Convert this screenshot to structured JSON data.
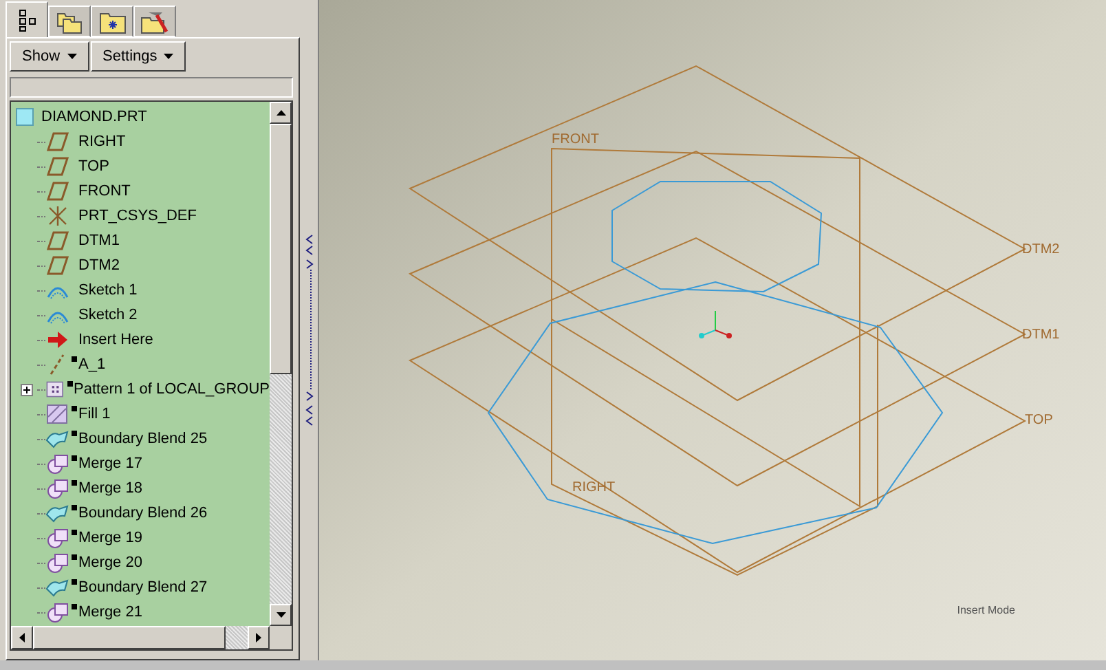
{
  "panel_tabs": [
    {
      "selected": true
    },
    {
      "selected": false
    },
    {
      "selected": false
    },
    {
      "selected": false
    }
  ],
  "toolbar": {
    "buttons": [
      "Show",
      "Settings"
    ]
  },
  "tree": {
    "root": "DIAMOND.PRT",
    "items": [
      {
        "label": "RIGHT",
        "kind": "plane",
        "marked": false
      },
      {
        "label": "TOP",
        "kind": "plane",
        "marked": false
      },
      {
        "label": "FRONT",
        "kind": "plane",
        "marked": false
      },
      {
        "label": "PRT_CSYS_DEF",
        "kind": "csys",
        "marked": false
      },
      {
        "label": "DTM1",
        "kind": "plane",
        "marked": false
      },
      {
        "label": "DTM2",
        "kind": "plane",
        "marked": false
      },
      {
        "label": "Sketch 1",
        "kind": "sketch",
        "marked": false
      },
      {
        "label": "Sketch 2",
        "kind": "sketch",
        "marked": false
      },
      {
        "label": "Insert Here",
        "kind": "insert",
        "marked": false
      },
      {
        "label": "A_1",
        "kind": "axis",
        "marked": true
      },
      {
        "label": "Pattern 1 of LOCAL_GROUP",
        "kind": "pattern",
        "marked": true,
        "expanded": false
      },
      {
        "label": "Fill 1",
        "kind": "fill",
        "marked": true
      },
      {
        "label": "Boundary Blend 25",
        "kind": "blend",
        "marked": true
      },
      {
        "label": "Merge 17",
        "kind": "merge",
        "marked": true
      },
      {
        "label": "Merge 18",
        "kind": "merge",
        "marked": true
      },
      {
        "label": "Boundary Blend 26",
        "kind": "blend",
        "marked": true
      },
      {
        "label": "Merge 19",
        "kind": "merge",
        "marked": true
      },
      {
        "label": "Merge 20",
        "kind": "merge",
        "marked": true
      },
      {
        "label": "Boundary Blend 27",
        "kind": "blend",
        "marked": true
      },
      {
        "label": "Merge 21",
        "kind": "merge",
        "marked": true
      }
    ]
  },
  "viewport": {
    "plane_labels": [
      {
        "text": "FRONT",
        "kind": "front"
      },
      {
        "text": "DTM2",
        "kind": "dtm2"
      },
      {
        "text": "DTM1",
        "kind": "dtm1"
      },
      {
        "text": "TOP",
        "kind": "top"
      },
      {
        "text": "RIGHT",
        "kind": "right"
      }
    ],
    "mode": "Insert Mode"
  }
}
